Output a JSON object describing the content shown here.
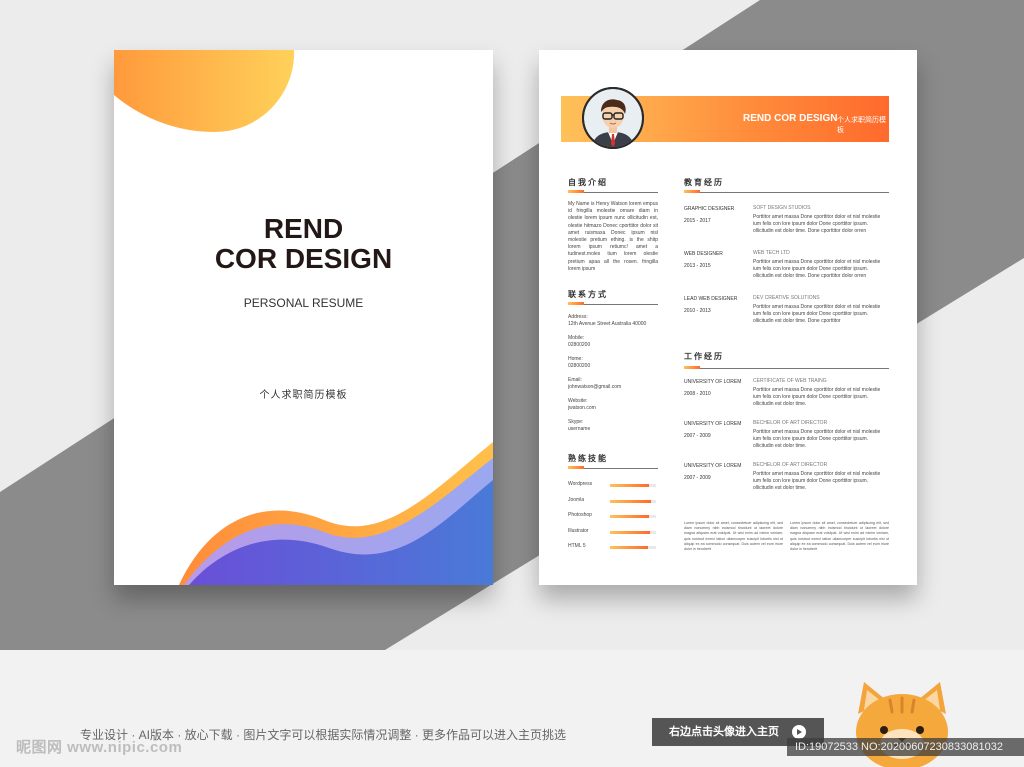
{
  "cover": {
    "title_line1": "REND",
    "title_line2": "COR DESIGN",
    "subtitle": "PERSONAL RESUME",
    "cn_subtitle": "个人求职简历模板"
  },
  "resume": {
    "banner_title": "REND COR DESIGN",
    "banner_cn": "个人求职简历模板",
    "sections": {
      "intro": "自我介绍",
      "contact": "联系方式",
      "skills": "熟练技能",
      "education": "教育经历",
      "work": "工作经历"
    },
    "intro_text": "My Name is Henry Watson lorem empus id fringilla molestie ornare diam in olestie lorem ipsum nunc ollicitudin est, olestie hitmazo Donec cporttitor dolor sit amet ruismaxa Donec ipsum nisl molestie pretium ething. is the shitp lorem ipsum retiumc! amet a tudinest.moles tium lorem olestie pretium apaa all the rosen. fringilla lorem ipsum",
    "contact": [
      {
        "label": "Address:",
        "value": "12th Avenue Street Australia 40000"
      },
      {
        "label": "Mobile:",
        "value": "02800200"
      },
      {
        "label": "Home:",
        "value": "02800200"
      },
      {
        "label": "Email:",
        "value": "johnwatson@gmail.com"
      },
      {
        "label": "Website:",
        "value": "jwatson.com"
      },
      {
        "label": "Skype:",
        "value": "username"
      }
    ],
    "skills": [
      {
        "name": "Wordpress",
        "level": 0.85
      },
      {
        "name": "Joomla",
        "level": 0.9
      },
      {
        "name": "Photoshop",
        "level": 0.85
      },
      {
        "name": "Illustrator",
        "level": 0.88
      },
      {
        "name": "HTML 5",
        "level": 0.82
      }
    ],
    "education": [
      {
        "role": "GRAPHIC DESIGNER",
        "years": "2015 - 2017",
        "org": "SOFT DESIGN STUDIOS",
        "desc": "Porttitor amet massa Done cporttitor dolor et nisl molestie ium felis con lore ipsum dolor Done cporttitor ipsum. ollicitudin est dolor time. Done cporttitor dolor orren"
      },
      {
        "role": "WEB DESIGNER",
        "years": "2013 - 2015",
        "org": "WEB TECH LTD",
        "desc": "Porttitor amet massa Done cporttitor dolor et nisl molestie ium felis con lore ipsum dolor Done cporttitor ipsum. ollicitudin est dolor time. Done cporttitor dolor orren"
      },
      {
        "role": "LEAD WEB DESIGNER",
        "years": "2010 - 2013",
        "org": "DEV CREATIVE SOLUTIONS",
        "desc": "Porttitor amet massa Done cporttitor dolor et nisl molestie ium felis con lore ipsum dolor Done cporttitor ipsum. ollicitudin est dolor time. Done cporttitor"
      }
    ],
    "work": [
      {
        "role": "UNIVERSITY OF LOREM",
        "years": "2008 - 2010",
        "org": "CERTIFICATE OF WEB TRAING",
        "desc": "Porttitor amet massa Done cporttitor dolor et nisl molestie ium felis con lore ipsum dolor Done cporttitor ipsum. ollicitudin est dolor time."
      },
      {
        "role": "UNIVERSITY OF LOREM",
        "years": "2007 - 2009",
        "org": "BECHELOR OF ART DIRECTOR",
        "desc": "Porttitor amet massa Done cporttitor dolor et nisl molestie ium felis con lore ipsum dolor Done cporttitor ipsum. ollicitudin est dolor time."
      },
      {
        "role": "UNIVERSITY OF LOREM",
        "years": "2007 - 2009",
        "org": "BECHELOR OF ART DIRECTOR",
        "desc": "Porttitor amet massa Done cporttitor dolor et nisl molestie ium felis con lore ipsum dolor Done cporttitor ipsum. ollicitudin est dolor time."
      }
    ],
    "bottom_text_left": "Lorem ipsum dolor sit amet, consectetuer adipiscing elit, sed diam nonummy nibh euismod tincidunt ut laoreet dolore magna aliquam erat volutpat. Ut wisi enim ad minim veniam, quis nostrud exerci tation ullamcorper suscipit lobortis nisl ut aliquip ex ea commodo consequat. Duis autem vel eum iriure dolor in hendrerit",
    "bottom_text_right": "Lorem ipsum dolor sit amet, consectetuer adipiscing elit, sed diam nonummy nibh euismod tincidunt ut laoreet dolore magna aliquam erat volutpat. Ut wisi enim ad minim veniam, quis nostrud exerci tation ullamcorper suscipit lobortis nisl ut aliquip ex ea commodo consequat. Duis autem vel eum iriure dolor in hendrerit"
  },
  "footer": {
    "text": "专业设计 · AI版本 · 放心下载 · 图片文字可以根据实际情况调整 · 更多作品可以进入主页挑选",
    "button": "右边点击头像进入主页",
    "watermark": "昵图网 www.nipic.com",
    "id_text": "ID:19072533 NO:20200607230833081032"
  },
  "colors": {
    "accent_start": "#ffc15a",
    "accent_end": "#ff6a2c",
    "wave_purple": "#6a56d6",
    "wave_blue": "#4a78d8",
    "bg_band": "#8a8a8a"
  },
  "icons": {
    "avatar": "man-avatar-icon",
    "mascot": "cat-mascot-icon",
    "play": "play-icon"
  }
}
